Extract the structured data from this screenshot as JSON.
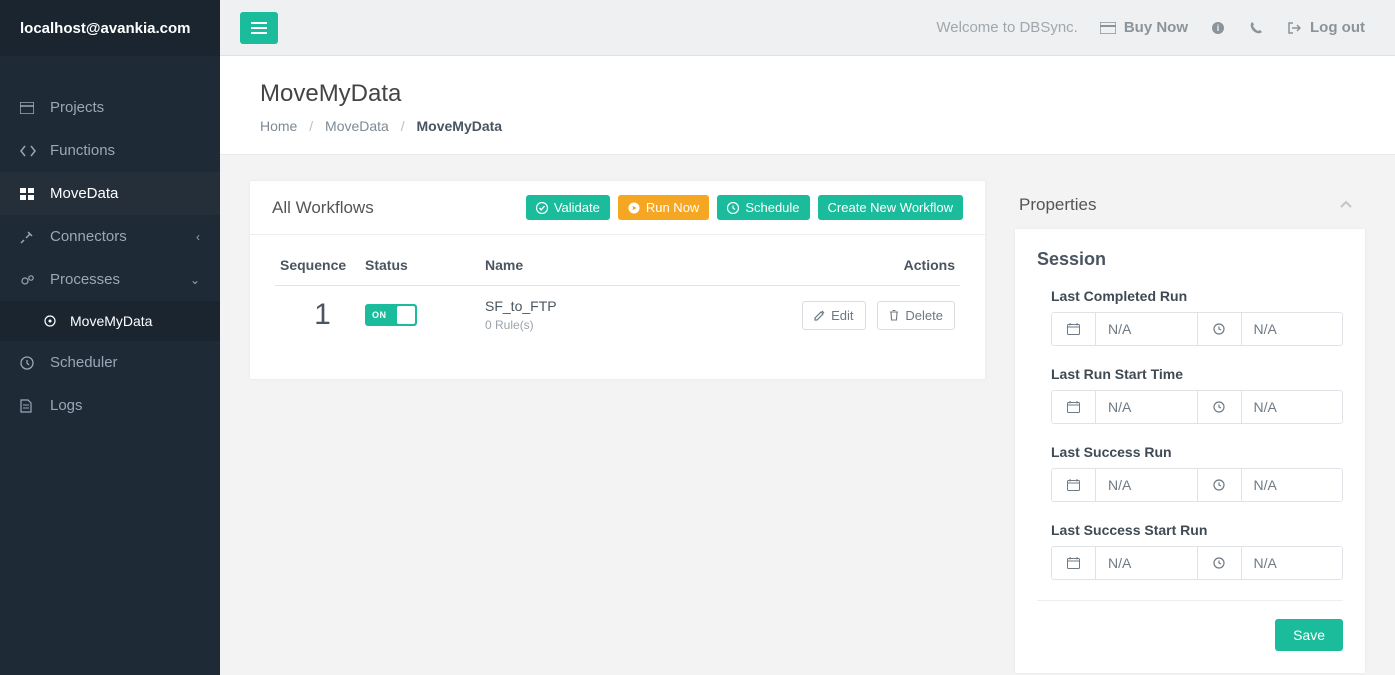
{
  "sidebar": {
    "tenant": "localhost@avankia.com",
    "items": [
      {
        "label": "Projects"
      },
      {
        "label": "Functions"
      },
      {
        "label": "MoveData"
      },
      {
        "label": "Connectors"
      },
      {
        "label": "Processes"
      },
      {
        "label": "Scheduler"
      },
      {
        "label": "Logs"
      }
    ],
    "subitems": [
      {
        "label": "MoveMyData"
      }
    ]
  },
  "topbar": {
    "welcome": "Welcome to DBSync.",
    "buy_now": "Buy Now",
    "logout": "Log out"
  },
  "page": {
    "title": "MoveMyData",
    "crumbs": [
      "Home",
      "MoveData",
      "MoveMyData"
    ]
  },
  "workflows": {
    "title": "All Workflows",
    "buttons": {
      "validate": "Validate",
      "run_now": "Run Now",
      "schedule": "Schedule",
      "create": "Create New Workflow"
    },
    "headers": {
      "sequence": "Sequence",
      "status": "Status",
      "name": "Name",
      "actions": "Actions"
    },
    "rows": [
      {
        "sequence": "1",
        "status_on": "ON",
        "name": "SF_to_FTP",
        "rules": "0 Rule(s)",
        "edit": "Edit",
        "delete": "Delete"
      }
    ]
  },
  "properties": {
    "title": "Properties",
    "section": "Session",
    "fields": [
      {
        "label": "Last Completed Run",
        "date": "N/A",
        "time": "N/A"
      },
      {
        "label": "Last Run Start Time",
        "date": "N/A",
        "time": "N/A"
      },
      {
        "label": "Last Success Run",
        "date": "N/A",
        "time": "N/A"
      },
      {
        "label": "Last Success Start Run",
        "date": "N/A",
        "time": "N/A"
      }
    ],
    "save": "Save"
  }
}
